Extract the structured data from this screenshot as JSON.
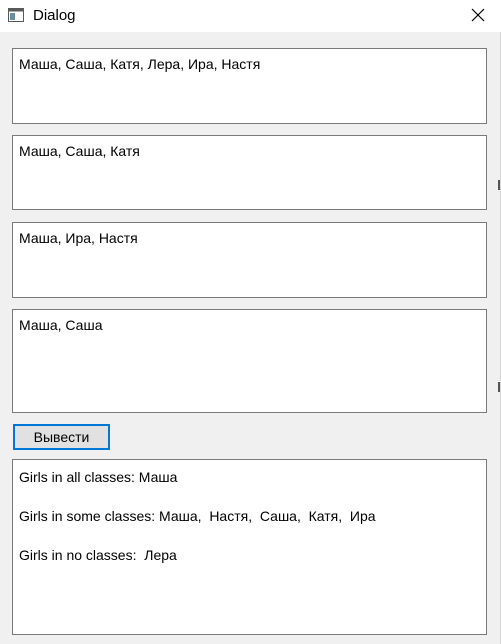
{
  "window": {
    "title": "Dialog"
  },
  "inputs": {
    "all_girls": "Маша, Саша, Катя, Лера, Ира, Настя",
    "class_1": "Маша, Саша, Катя",
    "class_2": "Маша, Ира, Настя",
    "class_3": "Маша, Саша"
  },
  "actions": {
    "submit_label": "Вывести"
  },
  "output": {
    "lines": [
      "Girls in all classes: Маша",
      "Girls in some classes: Маша,  Настя,  Саша,  Катя,  Ира",
      "Girls in no classes:  Лера"
    ]
  },
  "icons": {
    "app": "dialog-window-icon",
    "close": "close-icon"
  },
  "colors": {
    "button_focus": "#0078d7",
    "window_bg": "#f0f0f0"
  }
}
